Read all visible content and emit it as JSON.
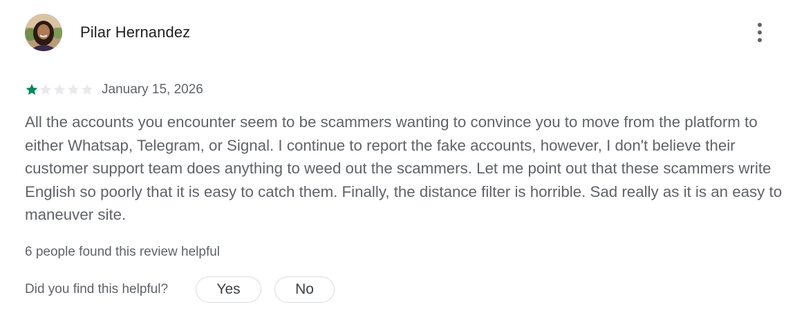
{
  "review": {
    "author": "Pilar Hernandez",
    "avatar_alt": "Pilar Hernandez avatar",
    "rating": 1,
    "rating_max": 5,
    "date": "January 15, 2026",
    "text": "All the accounts you encounter seem to be scammers wanting to convince you to move from the platform to either Whatsap, Telegram, or Signal. I continue to report the fake accounts, however, I don't believe their customer support team does anything to weed out the scammers. Let me point out that these scammers write English so poorly that it is easy to catch them. Finally, the distance filter is horrible. Sad really as it is an easy to maneuver site.",
    "helpful_count_text": "6 people found this review helpful"
  },
  "helpful": {
    "question": "Did you find this helpful?",
    "yes_label": "Yes",
    "no_label": "No"
  },
  "icons": {
    "more": "more-vert-icon",
    "star_filled": "star-filled-icon",
    "star_empty": "star-empty-icon"
  },
  "colors": {
    "star_filled": "#01875f",
    "star_empty": "#e8eaed",
    "author": "#202124",
    "text": "#5f6368",
    "pill_border": "#dadce0"
  }
}
